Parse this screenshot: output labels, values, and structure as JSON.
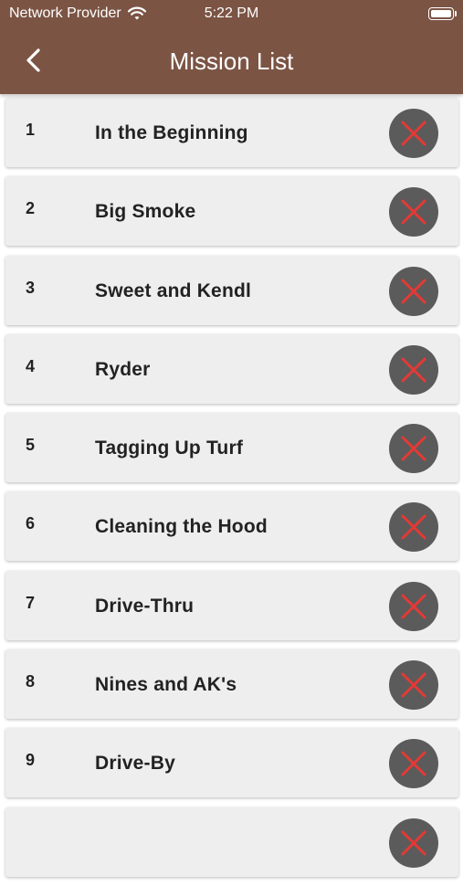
{
  "status_bar": {
    "carrier": "Network Provider",
    "time": "5:22 PM",
    "wifi_icon": "wifi-icon",
    "battery_icon": "battery-icon"
  },
  "nav": {
    "title": "Mission List",
    "back_icon": "chevron-left-icon"
  },
  "colors": {
    "header": "#7b5444",
    "card": "#eeeeee",
    "delete_button": "#5b5b5b",
    "delete_x": "#e53935"
  },
  "missions": [
    {
      "number": "1",
      "name": "In the Beginning"
    },
    {
      "number": "2",
      "name": "Big Smoke"
    },
    {
      "number": "3",
      "name": "Sweet and Kendl"
    },
    {
      "number": "4",
      "name": "Ryder"
    },
    {
      "number": "5",
      "name": "Tagging Up Turf"
    },
    {
      "number": "6",
      "name": "Cleaning the Hood"
    },
    {
      "number": "7",
      "name": "Drive-Thru"
    },
    {
      "number": "8",
      "name": "Nines and AK's"
    },
    {
      "number": "9",
      "name": "Drive-By"
    },
    {
      "number": "",
      "name": ""
    }
  ]
}
